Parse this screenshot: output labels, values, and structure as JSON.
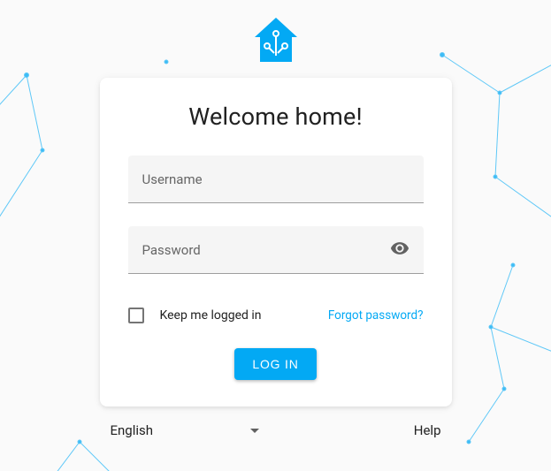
{
  "colors": {
    "accent": "#03a9f4"
  },
  "title": "Welcome home!",
  "fields": {
    "username": {
      "label": "Username",
      "value": ""
    },
    "password": {
      "label": "Password",
      "value": ""
    }
  },
  "keepLoggedIn": {
    "label": "Keep me logged in",
    "checked": false
  },
  "forgotPassword": "Forgot password?",
  "loginButton": "LOG IN",
  "footer": {
    "language": "English",
    "help": "Help"
  }
}
